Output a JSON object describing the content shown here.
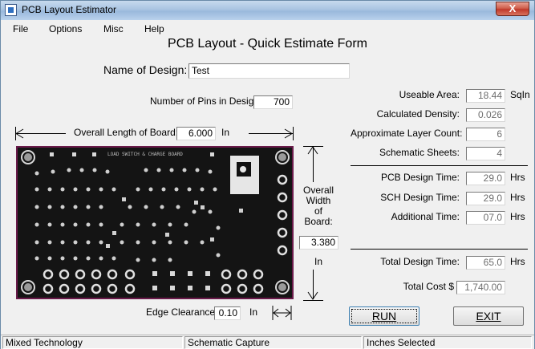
{
  "window": {
    "title": "PCB Layout Estimator",
    "close_glyph": "X"
  },
  "menu": {
    "items": [
      "File",
      "Options",
      "Misc",
      "Help"
    ]
  },
  "form": {
    "title": "PCB Layout - Quick Estimate Form",
    "name_label": "Name of Design:",
    "name_value": "Test",
    "pins_label": "Number of Pins in Design:",
    "pins_value": "700",
    "length_label": "Overall Length of Board:",
    "length_value": "6.000",
    "length_unit": "In",
    "width_label_1": "Overall",
    "width_label_2": "Width",
    "width_label_3": "of",
    "width_label_4": "Board:",
    "width_value": "3.380",
    "width_unit": "In",
    "edge_label": "Edge Clearance:",
    "edge_value": "0.10",
    "edge_unit": "In"
  },
  "results": {
    "useable_area_label": "Useable Area:",
    "useable_area_value": "18.44",
    "useable_area_unit": "SqIn",
    "density_label": "Calculated Density:",
    "density_value": "0.026",
    "layers_label": "Approximate Layer Count:",
    "layers_value": "6",
    "sheets_label": "Schematic Sheets:",
    "sheets_value": "4",
    "pcb_time_label": "PCB Design Time:",
    "pcb_time_value": "29.0",
    "pcb_time_unit": "Hrs",
    "sch_time_label": "SCH Design Time:",
    "sch_time_value": "29.0",
    "sch_time_unit": "Hrs",
    "add_time_label": "Additional Time:",
    "add_time_value": "07.0",
    "add_time_unit": "Hrs",
    "total_time_label": "Total Design Time:",
    "total_time_value": "65.0",
    "total_time_unit": "Hrs",
    "total_cost_label": "Total Cost $",
    "total_cost_value": "1,740.00"
  },
  "buttons": {
    "run_label": "RUN",
    "exit_label": "EXIT"
  },
  "status": {
    "cell1": "Mixed Technology",
    "cell2": "Schematic Capture",
    "cell3": "Inches Selected"
  },
  "colors": {
    "board_bg": "#141414",
    "board_border": "#6a1a4a",
    "pad": "#e8e8e8"
  }
}
